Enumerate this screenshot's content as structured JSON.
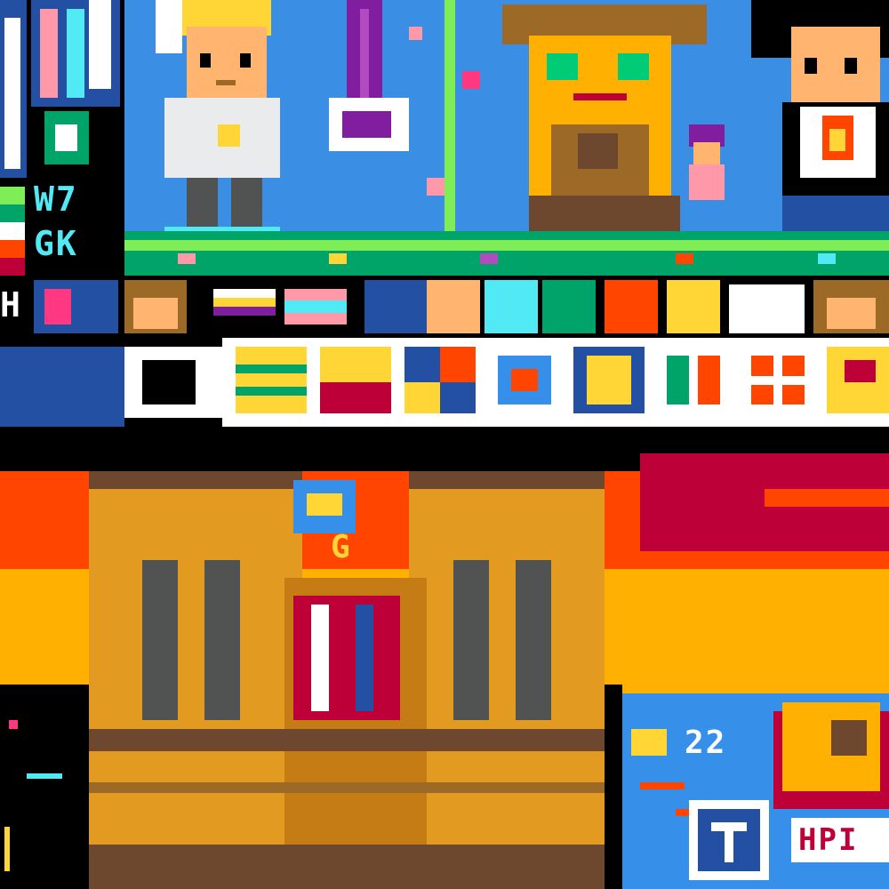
{
  "canvas": {
    "texts": {
      "w7": "W7",
      "gk": "GK",
      "h_letter": "H",
      "g_letter": "G",
      "w22": "22",
      "hpi": "HPI"
    },
    "colors": {
      "sky_blue": "#3a8fe4",
      "orange": "#ff4500",
      "yellow": "#ffb000",
      "gold": "#e39a20",
      "dark_red": "#be0039",
      "white": "#ffffff",
      "black": "#000000",
      "brown": "#8b5a2b",
      "navy": "#2450a4",
      "gray": "#515252",
      "teal": "#00a368"
    },
    "top_characters": [
      {
        "name": "blond-astronaut-boy",
        "icon": "astronaut-character-icon"
      },
      {
        "name": "scarecrow-straw-hat",
        "icon": "scarecrow-character-icon"
      },
      {
        "name": "dark-hair-flame-shirt",
        "icon": "flame-shirt-character-icon"
      }
    ],
    "emblem_row": [
      {
        "name": "heart-flag-1"
      },
      {
        "name": "face-brown-hair"
      },
      {
        "name": "nonbinary-flag"
      },
      {
        "name": "progress-pride-flag"
      },
      {
        "name": "blue-emblem"
      },
      {
        "name": "cat-face"
      },
      {
        "name": "teal-shape"
      },
      {
        "name": "green-figure"
      },
      {
        "name": "orange-fox"
      },
      {
        "name": "yellow-face"
      },
      {
        "name": "white-ghost"
      },
      {
        "name": "brown-face"
      }
    ],
    "shields": [
      {
        "name": "shield-yellow-green"
      },
      {
        "name": "shield-red-yellow"
      },
      {
        "name": "shield-blue-orange"
      },
      {
        "name": "shield-white-blue"
      },
      {
        "name": "shield-yellow-blue"
      },
      {
        "name": "shield-green-white"
      },
      {
        "name": "shield-orange-cross"
      },
      {
        "name": "shield-yellow-red"
      }
    ]
  }
}
